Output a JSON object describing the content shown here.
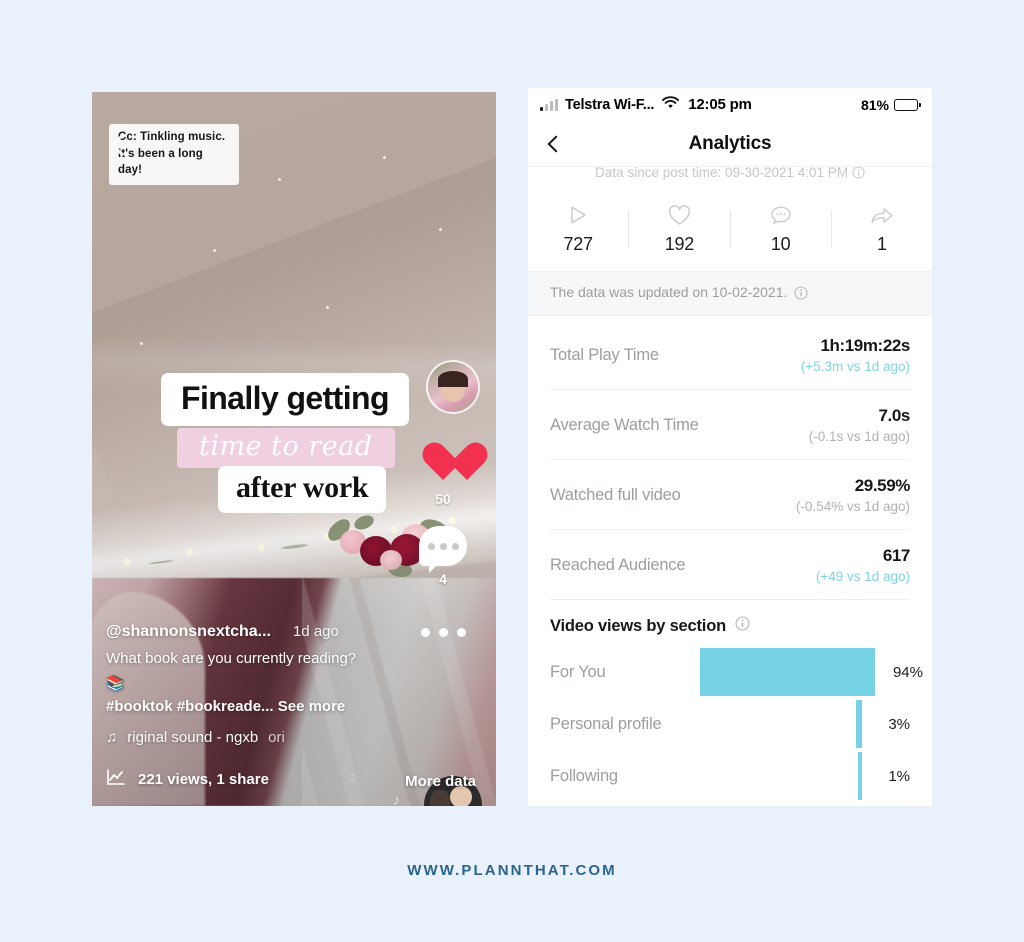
{
  "background_color": "#e9f2fc",
  "footer": {
    "url": "WWW.PLANNTHAT.COM",
    "color": "#2c6490"
  },
  "video": {
    "caption_chip": "Cc: Tinkling music.\nIt's been a long day!",
    "overlay_line1": "Finally getting",
    "overlay_line2": "time to read",
    "overlay_line3": "after work",
    "overlay_line2_bg": "#f0cfe0",
    "username": "@shannonsnextcha...",
    "posted": "1d ago",
    "caption_text": "What book are you currently reading? 📚",
    "hashtags": "#booktok #bookreade...",
    "see_more": "See more",
    "sound_icon": "♫",
    "sound_name": "riginal sound - ngxb",
    "sound_name_repeat": "ori",
    "like_count": "50",
    "comment_count": "4",
    "stats_icon": "📈",
    "stats_text": "221 views, 1 share",
    "more_data": "More data",
    "heart_color": "#f2304f"
  },
  "analytics": {
    "status_bar": {
      "carrier": "Telstra Wi-F...",
      "time": "12:05 pm",
      "battery_pct": "81%",
      "battery_level": 81
    },
    "nav": {
      "title": "Analytics",
      "back": "back-chevron"
    },
    "since_line": "Data since post time: 09-30-2021 4:01 PM",
    "kpis": [
      {
        "icon": "play-icon",
        "value": "727"
      },
      {
        "icon": "heart-icon",
        "value": "192"
      },
      {
        "icon": "comment-icon",
        "value": "10"
      },
      {
        "icon": "share-icon",
        "value": "1"
      }
    ],
    "update_banner": "The data was updated on 10-02-2021.",
    "metrics": [
      {
        "label": "Total Play Time",
        "value": "1h:19m:22s",
        "delta": "(+5.3m vs 1d ago)",
        "dir": "up"
      },
      {
        "label": "Average Watch Time",
        "value": "7.0s",
        "delta": "(-0.1s vs 1d ago)",
        "dir": "down"
      },
      {
        "label": "Watched full video",
        "value": "29.59%",
        "delta": "(-0.54% vs 1d ago)",
        "dir": "down"
      },
      {
        "label": "Reached Audience",
        "value": "617",
        "delta": "(+49 vs 1d ago)",
        "dir": "up"
      }
    ],
    "section_title": "Video views by section",
    "chart_data": {
      "type": "bar",
      "orientation": "horizontal",
      "title": "Video views by section",
      "categories": [
        "For You",
        "Personal profile",
        "Following"
      ],
      "values": [
        94,
        3,
        1
      ],
      "value_labels": [
        "94%",
        "3%",
        "1%"
      ],
      "bar_color": "#76d3e6",
      "xlabel": "",
      "ylabel": "",
      "xlim": [
        0,
        100
      ],
      "grid": false,
      "legend": false
    }
  }
}
